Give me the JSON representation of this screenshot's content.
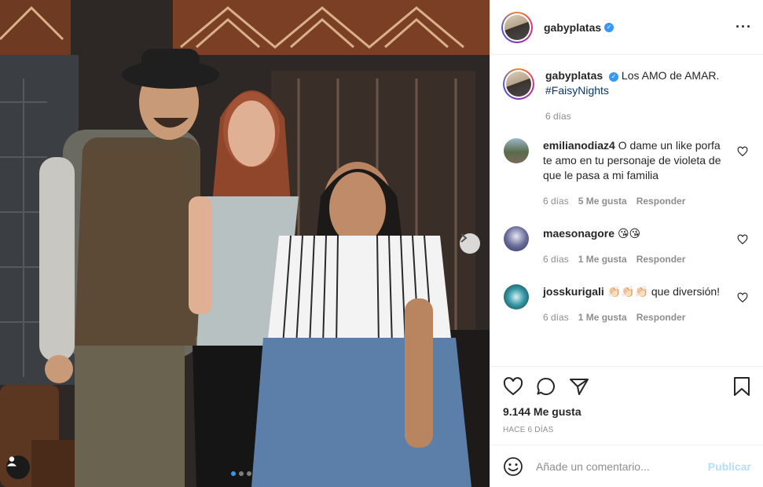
{
  "post": {
    "author": "gabyplatas",
    "verified_icon": "verified-badge-icon",
    "more_icon": "more-options-icon",
    "caption_text": "Los AMO de AMAR.",
    "caption_hashtag": "#FaisyNights",
    "caption_time": "6 días",
    "carousel": {
      "slides": 3,
      "active_slide": 1
    }
  },
  "comments": [
    {
      "user": "emilianodiaz4",
      "text": "O dame un like porfa te amo en tu personaje de violeta de que le pasa a mi familia",
      "time": "6 días",
      "likes": "5 Me gusta",
      "reply": "Responder"
    },
    {
      "user": "maesonagore",
      "text": "😘😘",
      "time": "6 días",
      "likes": "1 Me gusta",
      "reply": "Responder"
    },
    {
      "user": "josskurigali",
      "text": "👏🏻👏🏻👏🏻 que diversión!",
      "time": "6 días",
      "likes": "1 Me gusta",
      "reply": "Responder"
    }
  ],
  "actions": {
    "likes_count": "9.144 Me gusta",
    "posted_ago": "HACE 6 DÍAS"
  },
  "composer": {
    "placeholder": "Añade un comentario...",
    "publish_label": "Publicar"
  },
  "colors": {
    "link_blue": "#00376b",
    "verified_blue": "#3897f0",
    "muted_gray": "#8e8e8e",
    "publish_disabled": "#b2dffc"
  }
}
